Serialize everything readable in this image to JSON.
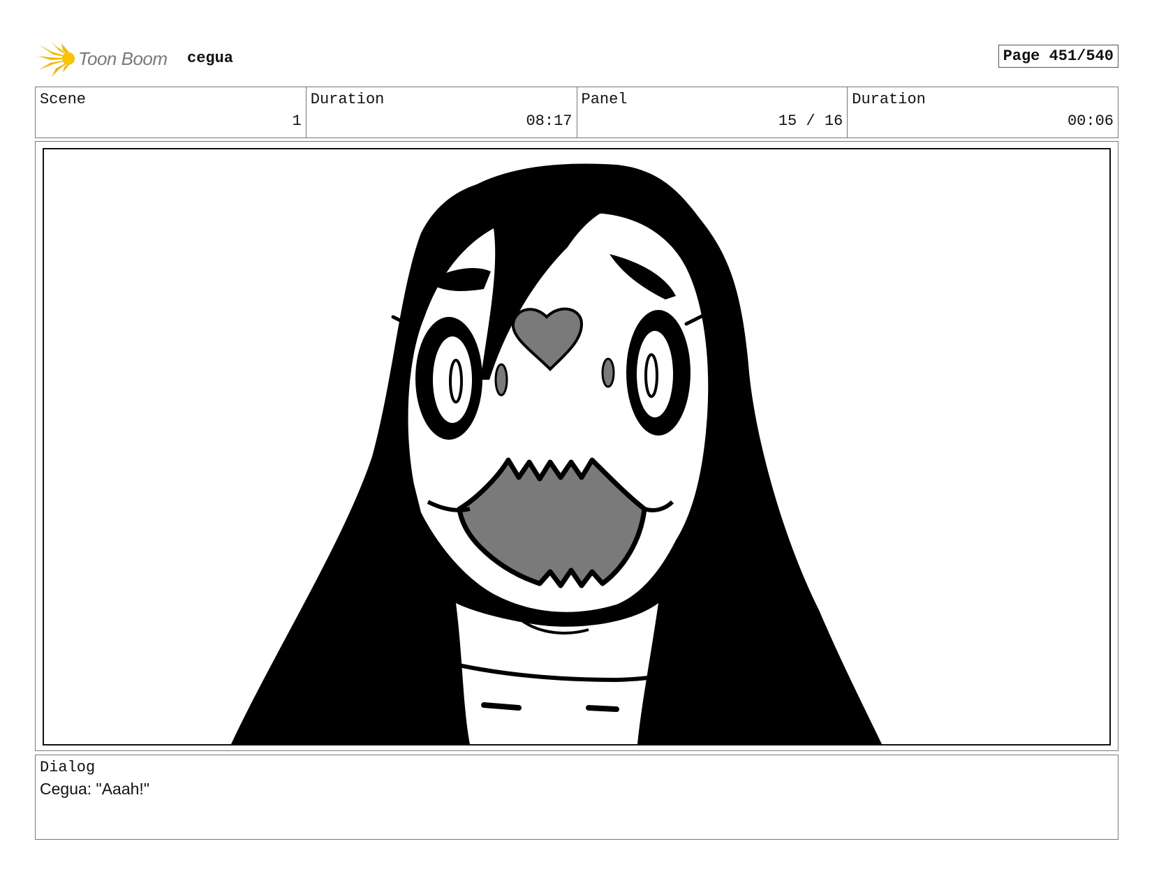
{
  "header": {
    "logo_text": "Toon Boom",
    "project_name": "cegua",
    "page_label": "Page 451/540",
    "logo_color": "#f5b800"
  },
  "info": {
    "scene_label": "Scene",
    "scene_value": "1",
    "scene_duration_label": "Duration",
    "scene_duration_value": "08:17",
    "panel_label": "Panel",
    "panel_value": "15 / 16",
    "panel_duration_label": "Duration",
    "panel_duration_value": "00:06"
  },
  "dialog": {
    "label": "Dialog",
    "text": "Cegua: \"Aaah!\""
  },
  "colors": {
    "ink": "#000000",
    "mouth_gray": "#7a7a7a"
  }
}
